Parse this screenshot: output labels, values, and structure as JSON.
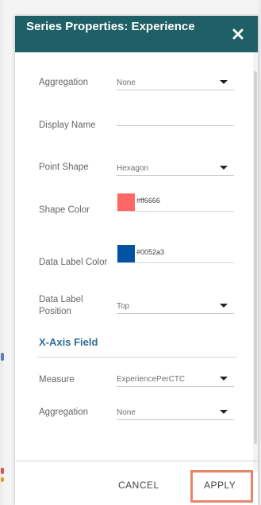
{
  "panel": {
    "title": "Series Properties: Experience",
    "close_icon": "close-icon"
  },
  "series": {
    "aggregation": {
      "label": "Aggregation",
      "value": "None"
    },
    "display_name": {
      "label": "Display Name",
      "value": ""
    },
    "point_shape": {
      "label": "Point Shape",
      "value": "Hexagon"
    },
    "shape_color": {
      "label": "Shape Color",
      "value": "#ff6666",
      "color": "#ff6666"
    },
    "data_label_color": {
      "label": "Data Label Color",
      "value": "#0052a3",
      "color": "#0052a3"
    },
    "data_label_position": {
      "label_line1": "Data Label",
      "label_line2": "Position",
      "value": "Top"
    }
  },
  "x_axis": {
    "section_title": "X-Axis Field",
    "measure": {
      "label": "Measure",
      "value": "ExperiencePerCTC"
    },
    "aggregation": {
      "label": "Aggregation",
      "value": "None"
    }
  },
  "footer": {
    "cancel_label": "CANCEL",
    "apply_label": "APPLY"
  },
  "colors": {
    "header": "#1f5f66",
    "section_title": "#2e6f95",
    "apply_highlight": "#e8846a"
  }
}
